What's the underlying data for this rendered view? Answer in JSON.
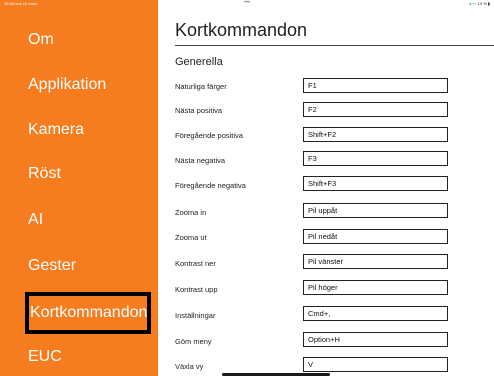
{
  "status_bar": {
    "time": "15:48",
    "date": "ons 12 mars",
    "dots": "•••",
    "battery": "13 %"
  },
  "sidebar": {
    "items": [
      {
        "label": "Om"
      },
      {
        "label": "Applikation"
      },
      {
        "label": "Kamera"
      },
      {
        "label": "Röst"
      },
      {
        "label": "AI"
      },
      {
        "label": "Gester"
      },
      {
        "label": "Kortkommandon",
        "selected": true
      },
      {
        "label": "EUC"
      }
    ]
  },
  "main": {
    "title": "Kortkommandon",
    "section": "Generella",
    "rows": [
      {
        "label": "Naturliga färger",
        "value": "F1"
      },
      {
        "label": "Nästa positiva",
        "value": "F2"
      },
      {
        "label": "Föregående positiva",
        "value": "Shift+F2"
      },
      {
        "label": "Nästa negativa",
        "value": "F3"
      },
      {
        "label": "Föregående negativa",
        "value": "Shift+F3"
      },
      {
        "label": "Zooma in",
        "value": "Pil uppåt"
      },
      {
        "label": "Zooma ut",
        "value": "Pil nedåt"
      },
      {
        "label": "Kontrast ner",
        "value": "Pil vänster"
      },
      {
        "label": "Kontrast upp",
        "value": "Pil höger"
      },
      {
        "label": "Inställningar",
        "value": "Cmd+,"
      },
      {
        "label": "Göm meny",
        "value": "Option+H"
      },
      {
        "label": "Växla vy",
        "value": "V"
      }
    ]
  },
  "colors": {
    "sidebar_bg": "#f57c1f",
    "selected_border": "#000000"
  }
}
